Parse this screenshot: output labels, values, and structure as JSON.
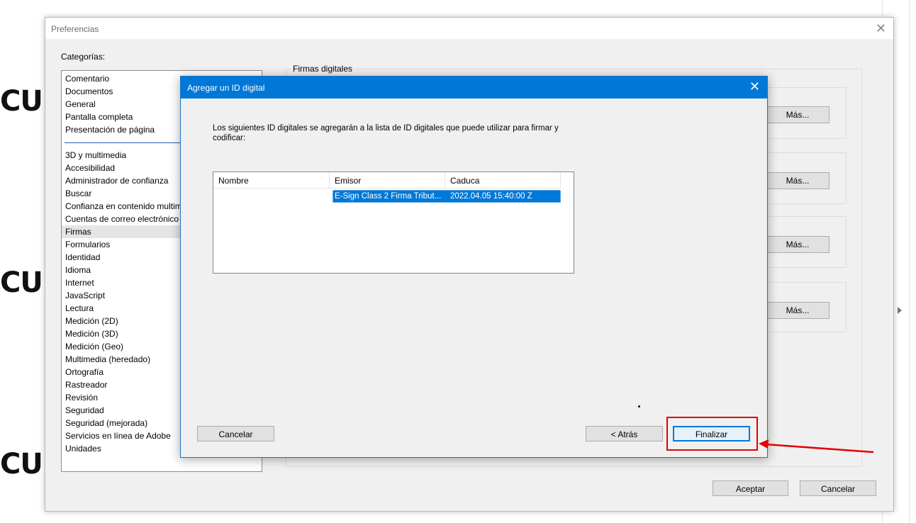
{
  "background_text": [
    "CUI",
    "CUI",
    "CUI"
  ],
  "preferences": {
    "title": "Preferencias",
    "categories_label": "Categorías:",
    "categories_top": [
      "Comentario",
      "Documentos",
      "General",
      "Pantalla completa",
      "Presentación de página"
    ],
    "categories": [
      "3D y multimedia",
      "Accesibilidad",
      "Administrador de confianza",
      "Buscar",
      "Confianza en contenido multim",
      "Cuentas de correo electrónico",
      "Firmas",
      "Formularios",
      "Identidad",
      "Idioma",
      "Internet",
      "JavaScript",
      "Lectura",
      "Medición (2D)",
      "Medición (3D)",
      "Medición (Geo)",
      "Multimedia (heredado)",
      "Ortografía",
      "Rastreador",
      "Revisión",
      "Seguridad",
      "Seguridad (mejorada)",
      "Servicios en línea de Adobe",
      "Unidades"
    ],
    "selected_category": "Firmas",
    "group_title": "Firmas digitales",
    "more_buttons": [
      "Más...",
      "Más...",
      "Más...",
      "Más..."
    ],
    "accept_label": "Aceptar",
    "cancel_label": "Cancelar"
  },
  "dialog": {
    "title": "Agregar un ID digital",
    "intro": "Los siguientes ID digitales se agregarán a la lista de ID digitales que puede utilizar para firmar y codificar:",
    "columns": [
      "Nombre",
      "Emisor",
      "Caduca"
    ],
    "rows": [
      {
        "name": "",
        "issuer": "E-Sign Class 2 Firma Tribut...",
        "expires": "2022.04.05 15:40:00 Z"
      }
    ],
    "cancel_label": "Cancelar",
    "back_label": "< Atrás",
    "finish_label": "Finalizar"
  },
  "annotation": {
    "color": "#e30000"
  },
  "colors": {
    "accent": "#0078d7",
    "selection": "#0078d7"
  }
}
